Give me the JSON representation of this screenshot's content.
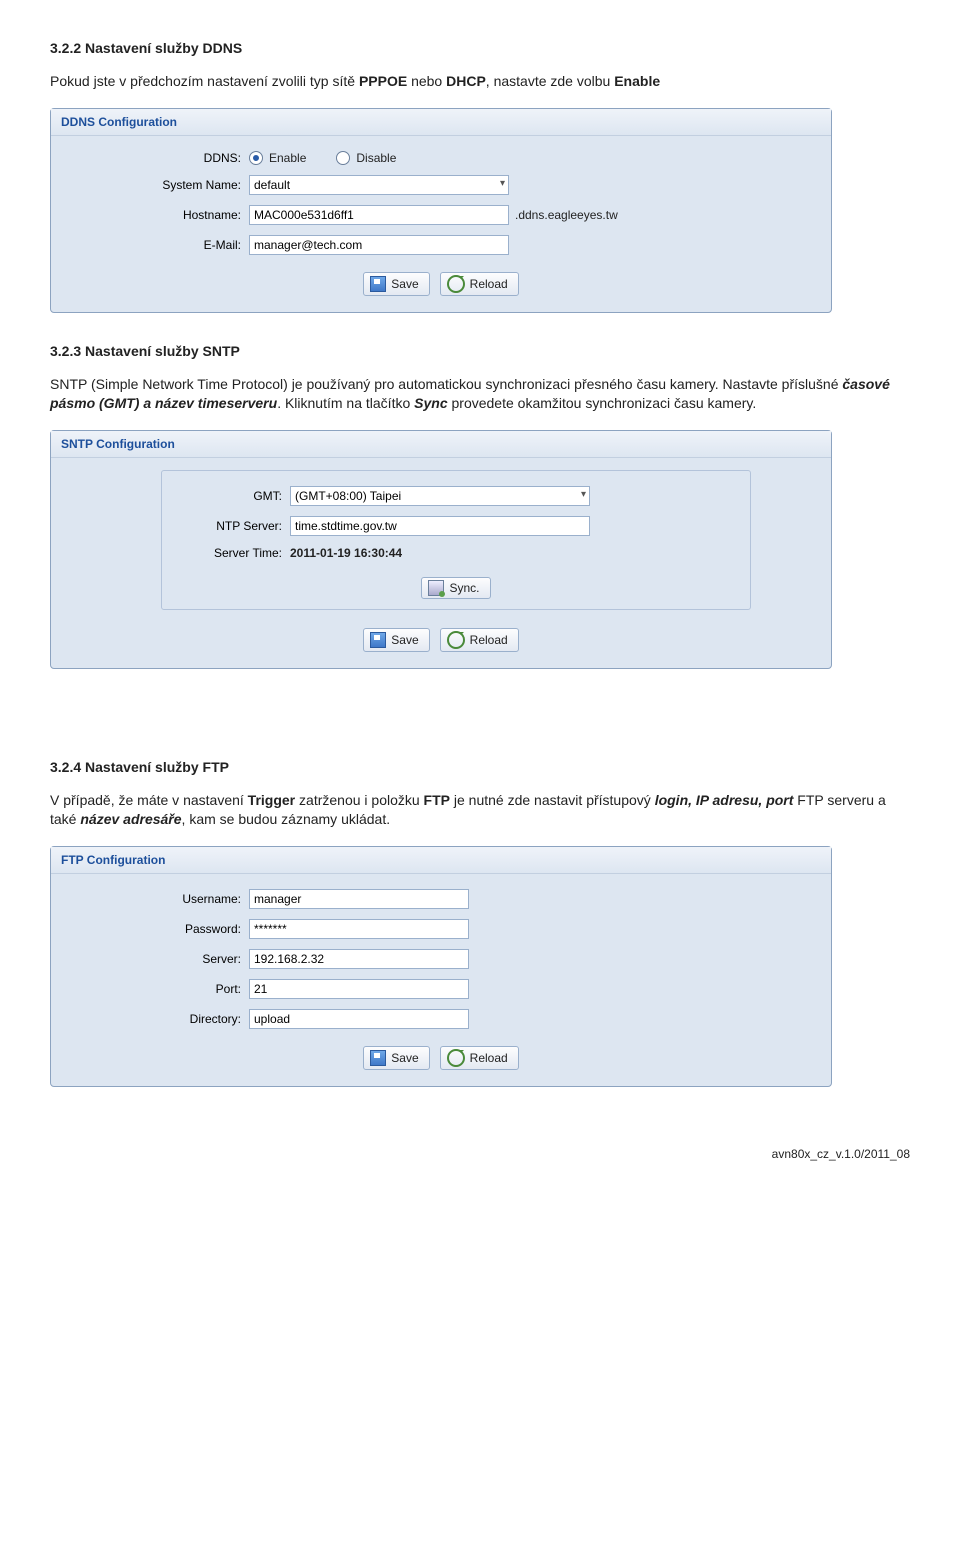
{
  "s1": {
    "heading": "3.2.2 Nastavení služby DDNS",
    "para_pre": "Pokud jste v předchozím nastavení zvolili typ sítě ",
    "pppoe": "PPPOE",
    "para_mid1": " nebo ",
    "dhcp": "DHCP",
    "para_mid2": ", nastavte zde volbu ",
    "enable": "Enable"
  },
  "ddns": {
    "title": "DDNS Configuration",
    "labels": {
      "ddns": "DDNS:",
      "system": "System Name:",
      "host": "Hostname:",
      "email": "E-Mail:"
    },
    "radio_enable": "Enable",
    "radio_disable": "Disable",
    "system_val": "default",
    "host_val": "MAC000e531d6ff1",
    "host_suffix": ".ddns.eagleeyes.tw",
    "email_val": "manager@tech.com"
  },
  "buttons": {
    "save": "Save",
    "reload": "Reload",
    "sync": "Sync."
  },
  "s2": {
    "heading": "3.2.3 Nastavení služby SNTP",
    "p1": "SNTP (Simple Network Time Protocol) je používaný pro automatickou synchronizaci přesného času kamery. Nastavte příslušné ",
    "p1b": "časové pásmo (GMT) a název timeserveru",
    "p1_after": ". Kliknutím na tlačítko ",
    "p1sync": "Sync",
    "p1_end": " provedete okamžitou synchronizaci času kamery."
  },
  "sntp": {
    "title": "SNTP Configuration",
    "labels": {
      "gmt": "GMT:",
      "ntp": "NTP Server:",
      "stime": "Server Time:"
    },
    "gmt_val": "(GMT+08:00) Taipei",
    "ntp_val": "time.stdtime.gov.tw",
    "server_time": "2011-01-19 16:30:44"
  },
  "s3": {
    "heading": "3.2.4 Nastavení služby FTP",
    "p_pre": "V případě, že máte v nastavení ",
    "trigger": "Trigger",
    "p_mid1": " zatrženou i položku ",
    "ftp": "FTP",
    "p_mid2": " je nutné zde nastavit přístupový ",
    "login": "login, IP adresu, port",
    "p_mid3": " FTP serveru a také ",
    "dir": "název adresáře",
    "p_end": ", kam se budou záznamy ukládat."
  },
  "ftp": {
    "title": "FTP Configuration",
    "labels": {
      "user": "Username:",
      "pass": "Password:",
      "server": "Server:",
      "port": "Port:",
      "dir": "Directory:"
    },
    "user_val": "manager",
    "pass_val": "*******",
    "server_val": "192.168.2.32",
    "port_val": "21",
    "dir_val": "upload"
  },
  "footer": "avn80x_cz_v.1.0/2011_08"
}
